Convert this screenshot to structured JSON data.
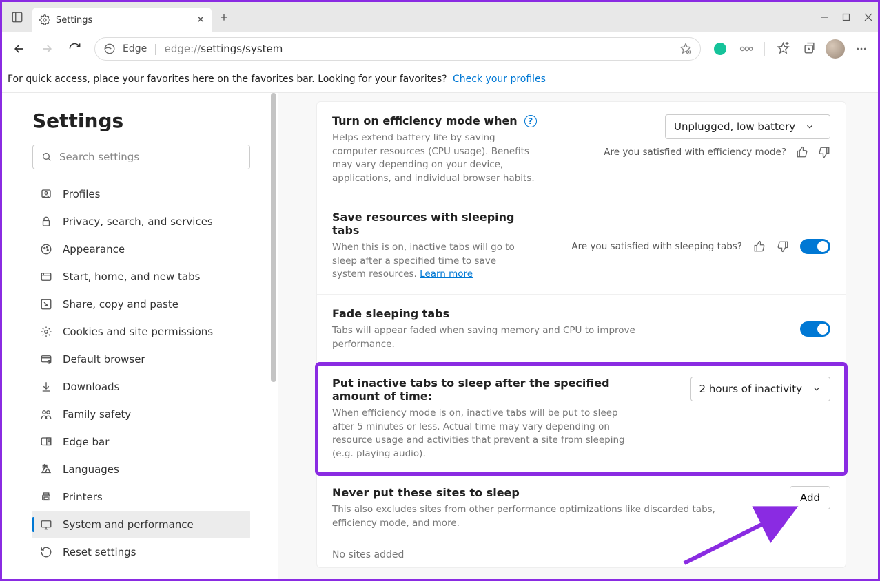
{
  "tab": {
    "title": "Settings"
  },
  "address": {
    "prefix": "Edge",
    "proto": "edge://",
    "path": "settings/system"
  },
  "favbar": {
    "text": "For quick access, place your favorites here on the favorites bar. Looking for your favorites?",
    "link": "Check your profiles"
  },
  "sidebar": {
    "heading": "Settings",
    "search_placeholder": "Search settings",
    "items": [
      {
        "label": "Profiles"
      },
      {
        "label": "Privacy, search, and services"
      },
      {
        "label": "Appearance"
      },
      {
        "label": "Start, home, and new tabs"
      },
      {
        "label": "Share, copy and paste"
      },
      {
        "label": "Cookies and site permissions"
      },
      {
        "label": "Default browser"
      },
      {
        "label": "Downloads"
      },
      {
        "label": "Family safety"
      },
      {
        "label": "Edge bar"
      },
      {
        "label": "Languages"
      },
      {
        "label": "Printers"
      },
      {
        "label": "System and performance"
      },
      {
        "label": "Reset settings"
      }
    ],
    "active_index": 12
  },
  "settings": {
    "efficiency": {
      "title": "Turn on efficiency mode when",
      "desc": "Helps extend battery life by saving computer resources (CPU usage). Benefits may vary depending on your device, applications, and individual browser habits.",
      "select_value": "Unplugged, low battery",
      "feedback": "Are you satisfied with efficiency mode?"
    },
    "sleeping": {
      "title": "Save resources with sleeping tabs",
      "desc": "When this is on, inactive tabs will go to sleep after a specified time to save system resources. ",
      "learn": "Learn more",
      "feedback": "Are you satisfied with sleeping tabs?"
    },
    "fade": {
      "title": "Fade sleeping tabs",
      "desc": "Tabs will appear faded when saving memory and CPU to improve performance."
    },
    "inactive": {
      "title": "Put inactive tabs to sleep after the specified amount of time:",
      "desc": "When efficiency mode is on, inactive tabs will be put to sleep after 5 minutes or less. Actual time may vary depending on resource usage and activities that prevent a site from sleeping (e.g. playing audio).",
      "select_value": "2 hours of inactivity"
    },
    "never": {
      "title": "Never put these sites to sleep",
      "desc": "This also excludes sites from other performance optimizations like discarded tabs, efficiency mode, and more.",
      "add": "Add",
      "empty": "No sites added"
    }
  }
}
